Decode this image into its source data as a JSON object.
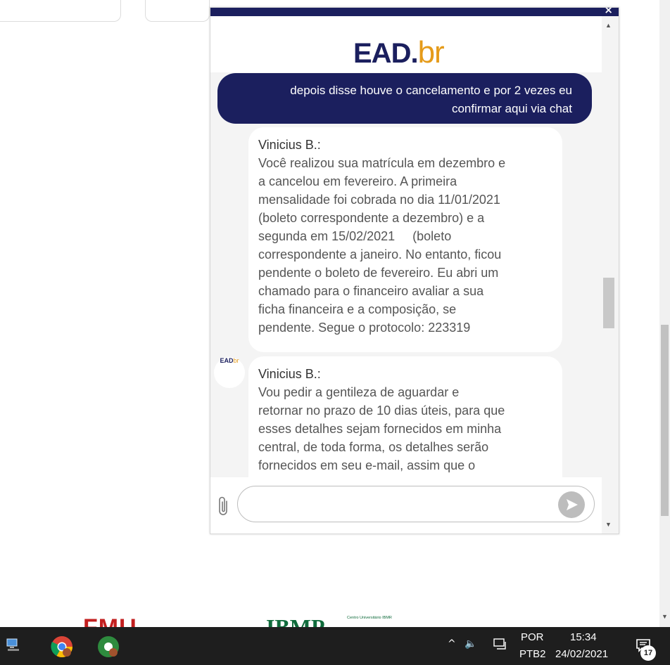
{
  "chat": {
    "close_label": "×",
    "brand": {
      "main": "EAD",
      "dot": ".",
      "suffix": "br"
    },
    "messages": [
      {
        "from": "user",
        "lines": [
          "depois disse houve o cancelamento e por 2 vezes eu",
          "confirmar aqui via chat"
        ]
      },
      {
        "from": "bot",
        "sender": "Vinicius  B.:",
        "lines": [
          "Você realizou sua matrícula em dezembro e",
          "a cancelou em fevereiro. A primeira",
          "mensalidade foi cobrada no dia 11/01/2021",
          "(boleto correspondente a dezembro) e a",
          "segunda em 15/02/2021     (boleto",
          "correspondente a janeiro. No entanto, ficou",
          "pendente o boleto de fevereiro. Eu abri um",
          "chamado para o financeiro avaliar a sua",
          "ficha financeira e a composição, se",
          "pendente. Segue o protocolo: 223319"
        ]
      },
      {
        "from": "bot",
        "sender": "Vinicius  B.:",
        "lines": [
          "Vou pedir a gentileza de aguardar e",
          "retornar no prazo de 10 dias úteis, para que",
          "esses detalhes sejam fornecidos em minha",
          "central, de toda forma, os detalhes serão",
          "fornecidos em seu e-mail, assim que o"
        ]
      }
    ],
    "avatar": {
      "main": "EAD",
      "suffix": "br"
    },
    "input": {
      "value": "",
      "placeholder": ""
    }
  },
  "page": {
    "logo_fmu": "FMU",
    "logo_ibmp": "IBMP",
    "logo_ibmp_sub": "Centro Universitário IBMR"
  },
  "taskbar": {
    "lang_line1": "POR",
    "lang_line2": "PTB2",
    "time": "15:34",
    "date": "24/02/2021",
    "notification_count": "17"
  },
  "colors": {
    "brand_navy": "#1b1f5e",
    "brand_orange": "#e59b1a",
    "taskbar": "#1e1e1e"
  }
}
